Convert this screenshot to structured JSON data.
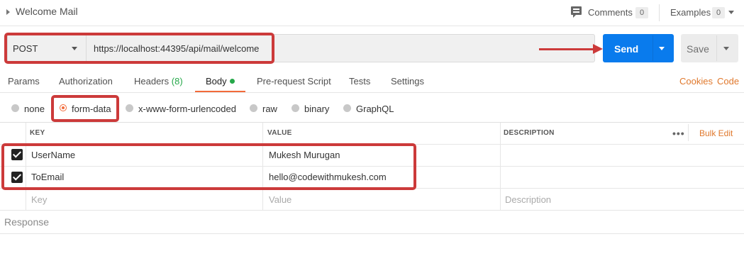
{
  "title": "Welcome Mail",
  "header": {
    "comments_label": "Comments",
    "comments_count": "0",
    "examples_label": "Examples",
    "examples_count": "0"
  },
  "request": {
    "method": "POST",
    "url": "https://localhost:44395/api/mail/welcome",
    "send_label": "Send",
    "save_label": "Save"
  },
  "tabs": [
    {
      "label": "Params"
    },
    {
      "label": "Authorization"
    },
    {
      "label": "Headers",
      "count": "(8)"
    },
    {
      "label": "Body",
      "active": true
    },
    {
      "label": "Pre-request Script"
    },
    {
      "label": "Tests"
    },
    {
      "label": "Settings"
    }
  ],
  "links": {
    "cookies": "Cookies",
    "code": "Code"
  },
  "body_types": [
    {
      "label": "none"
    },
    {
      "label": "form-data",
      "selected": true
    },
    {
      "label": "x-www-form-urlencoded"
    },
    {
      "label": "raw"
    },
    {
      "label": "binary"
    },
    {
      "label": "GraphQL"
    }
  ],
  "table": {
    "headers": {
      "key": "KEY",
      "value": "VALUE",
      "description": "DESCRIPTION"
    },
    "bulk_edit": "Bulk Edit",
    "more": "•••",
    "rows": [
      {
        "checked": true,
        "key": "UserName",
        "value": "Mukesh Murugan",
        "description": ""
      },
      {
        "checked": true,
        "key": "ToEmail",
        "value": "hello@codewithmukesh.com",
        "description": ""
      }
    ],
    "placeholders": {
      "key": "Key",
      "value": "Value",
      "description": "Description"
    }
  },
  "response_label": "Response",
  "colors": {
    "accent": "#f26b3a",
    "send": "#097bed",
    "annotation": "#cc3a3a",
    "link": "#e0782c"
  }
}
